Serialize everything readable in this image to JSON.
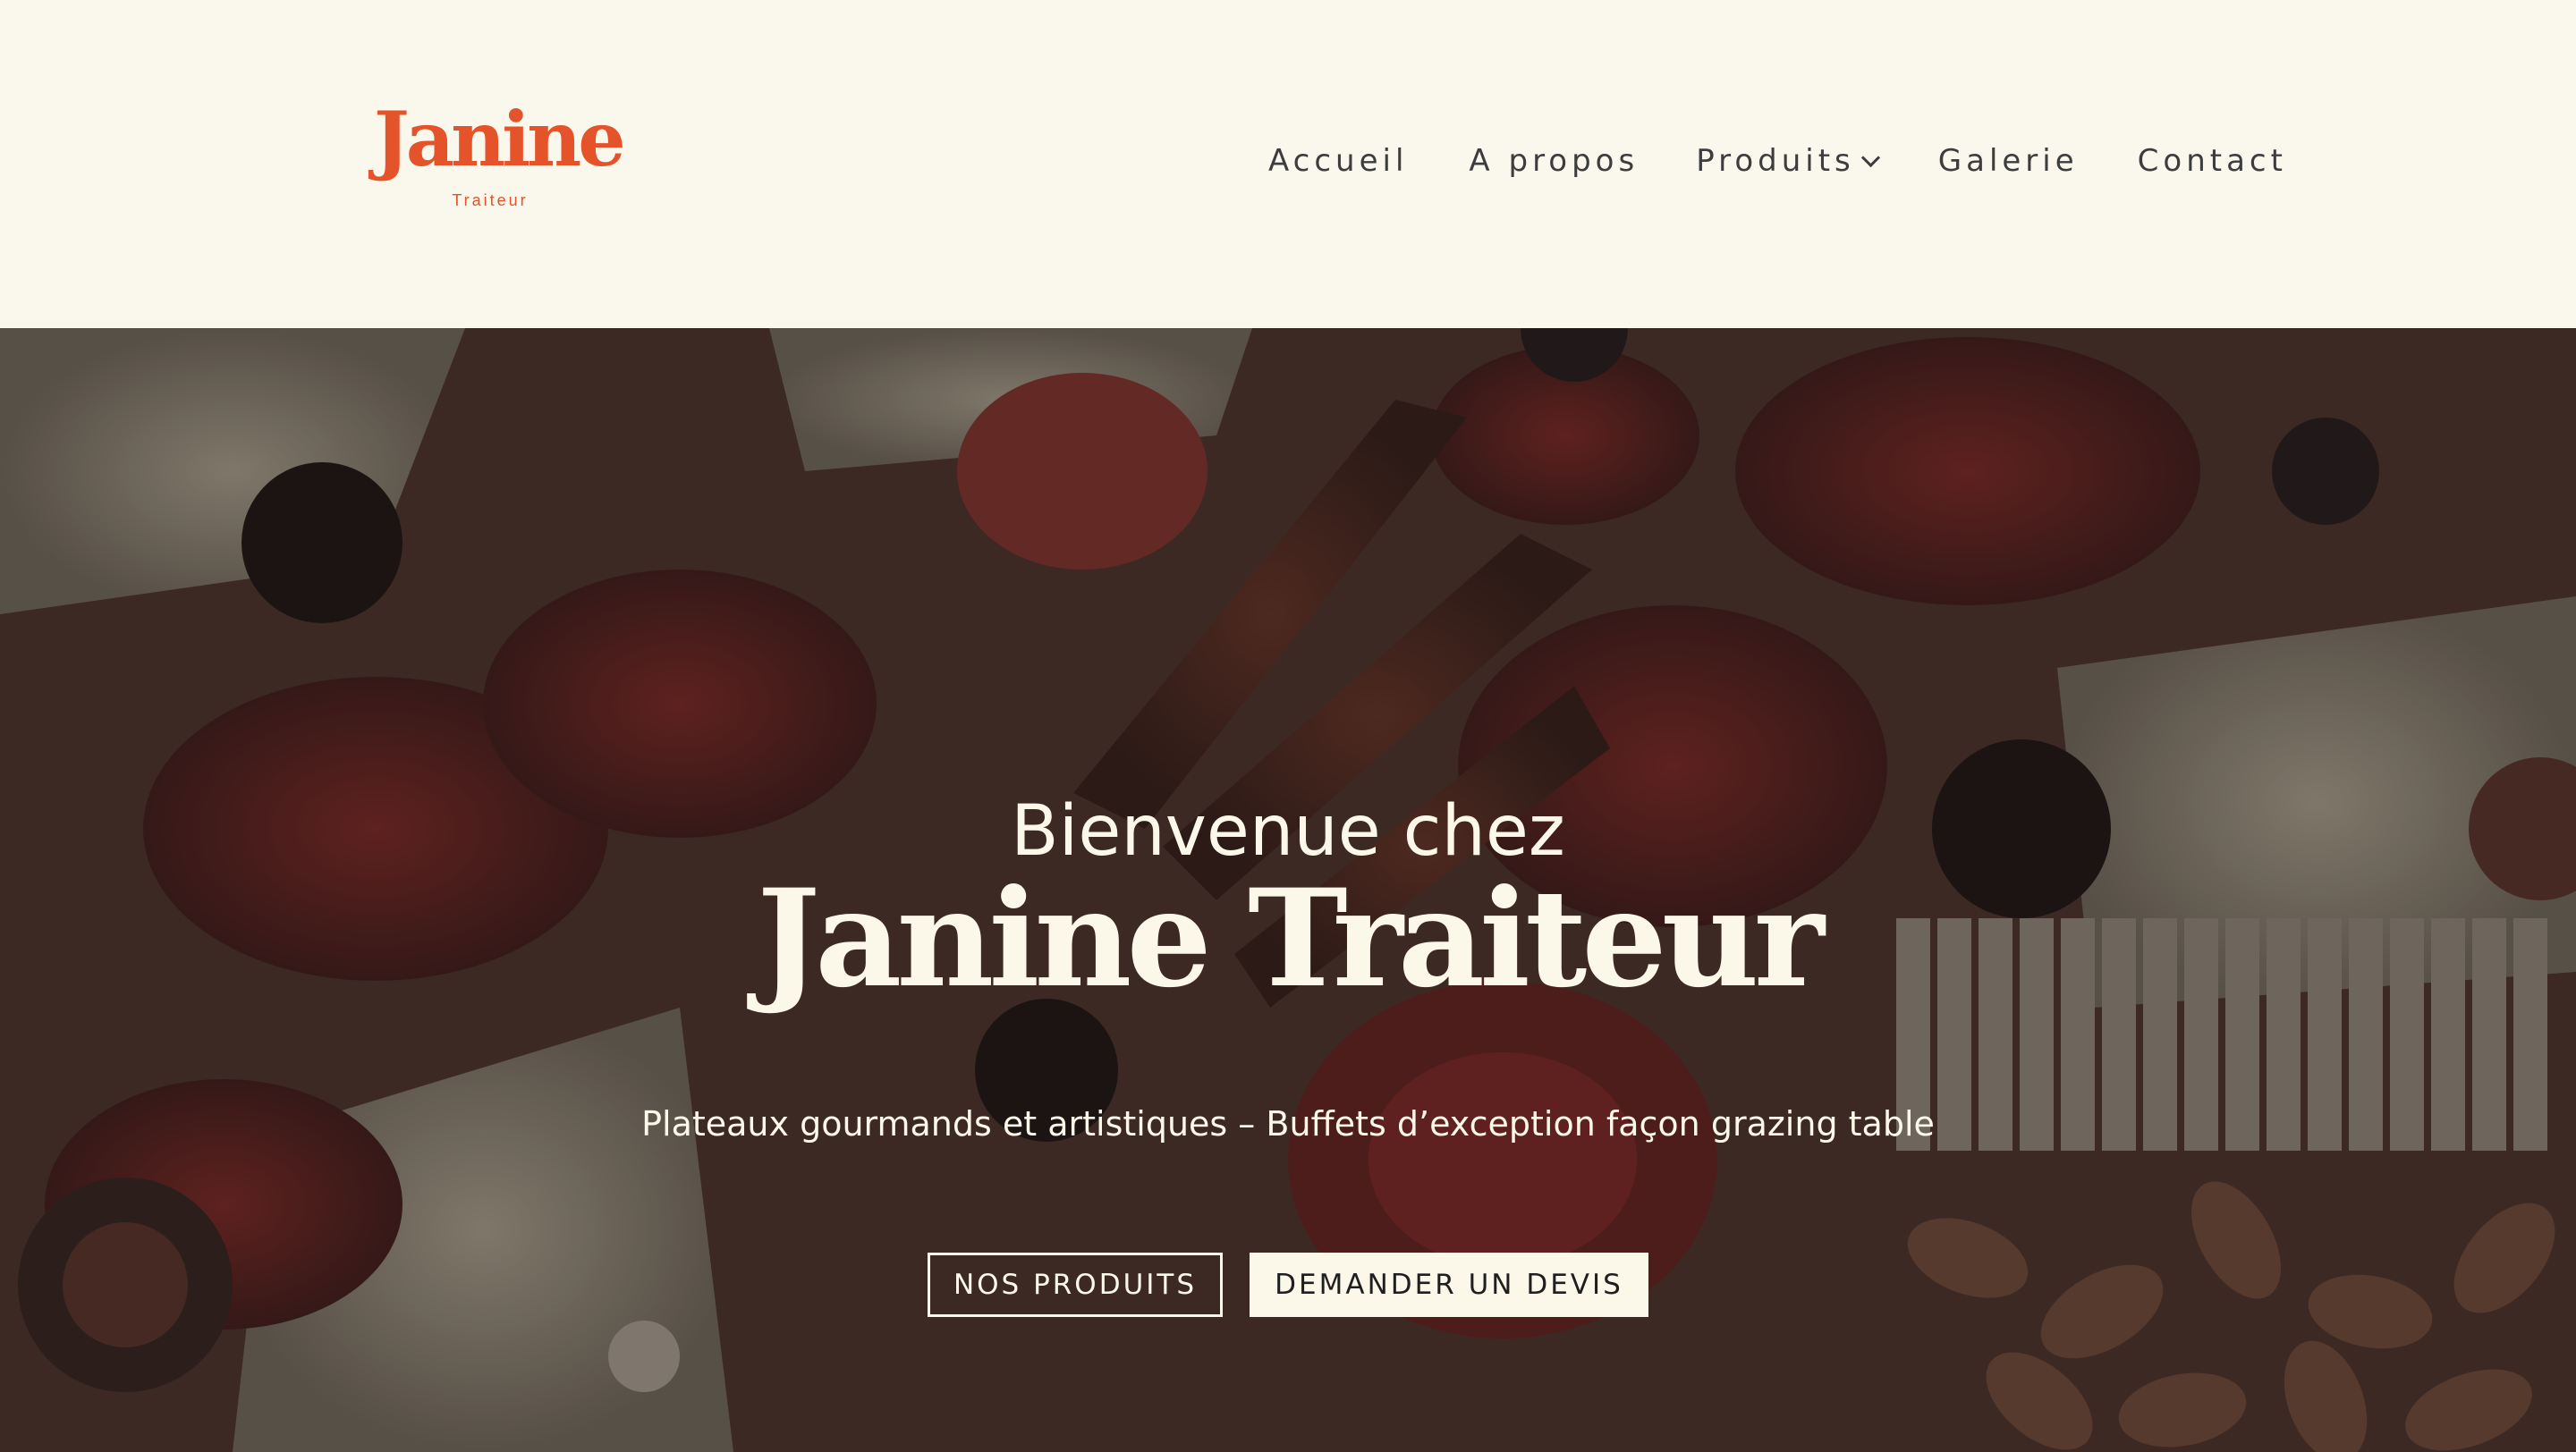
{
  "brand": {
    "name": "Janine",
    "tagline": "Traiteur",
    "color": "#e4532a"
  },
  "nav": {
    "items": [
      {
        "label": "Accueil"
      },
      {
        "label": "A propos"
      },
      {
        "label": "Produits",
        "has_dropdown": true,
        "icon": "chevron-down-icon"
      },
      {
        "label": "Galerie"
      },
      {
        "label": "Contact"
      }
    ]
  },
  "hero": {
    "welcome": "Bienvenue chez",
    "title": "Janine Traiteur",
    "subtitle": "Plateaux gourmands et artistiques – Buffets d’exception façon grazing table",
    "buttons": {
      "primary": "NOS PRODUITS",
      "secondary": "DEMANDER UN DEVIS"
    },
    "background": "charcuterie grazing board photo with dark overlay"
  },
  "colors": {
    "cream": "#faf8ec",
    "nav_text": "#3d3d3d",
    "hero_text": "#fbf8ea"
  }
}
